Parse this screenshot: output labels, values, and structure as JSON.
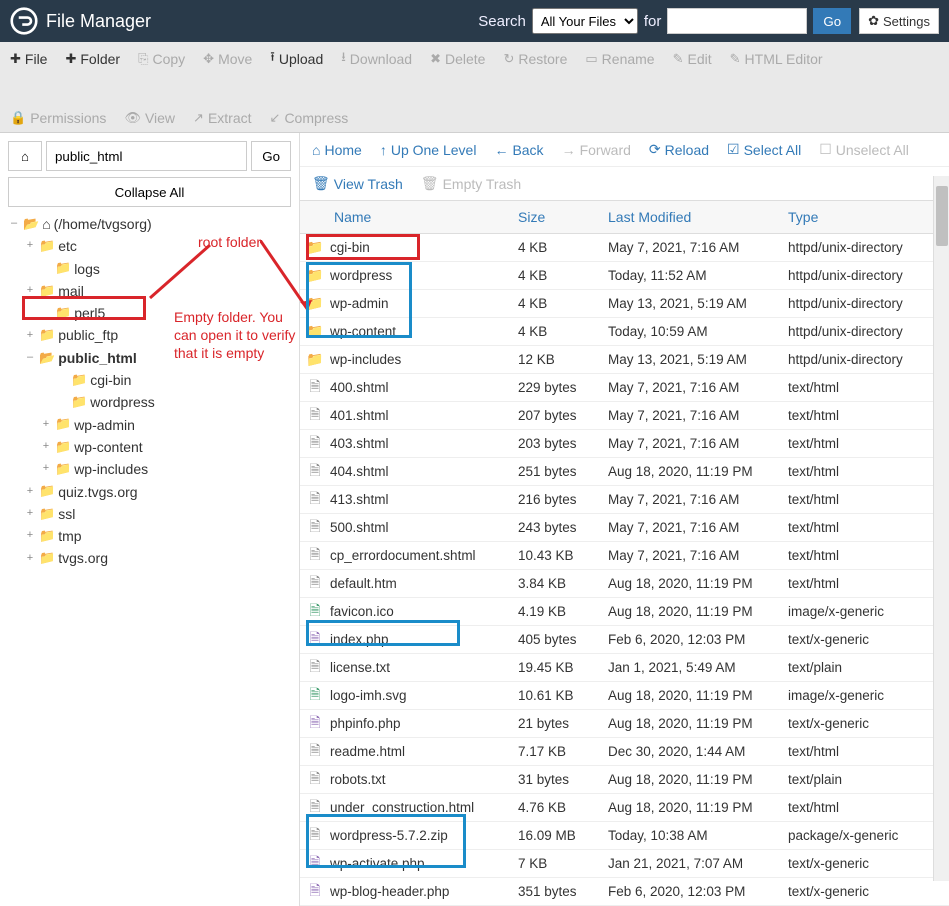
{
  "header": {
    "title": "File Manager",
    "search_label": "Search",
    "search_scope": "All Your Files",
    "for_label": "for",
    "search_value": "",
    "go_label": "Go",
    "settings_label": "Settings"
  },
  "toolbar": {
    "row1": [
      {
        "icon": "plus",
        "label": "File",
        "disabled": false
      },
      {
        "icon": "plus",
        "label": "Folder",
        "disabled": false
      },
      {
        "icon": "copy",
        "label": "Copy",
        "disabled": true
      },
      {
        "icon": "move",
        "label": "Move",
        "disabled": true
      },
      {
        "icon": "upload",
        "label": "Upload",
        "disabled": false
      },
      {
        "icon": "download",
        "label": "Download",
        "disabled": true
      },
      {
        "icon": "delete",
        "label": "Delete",
        "disabled": true
      },
      {
        "icon": "restore",
        "label": "Restore",
        "disabled": true
      },
      {
        "icon": "rename",
        "label": "Rename",
        "disabled": true
      },
      {
        "icon": "edit",
        "label": "Edit",
        "disabled": true
      },
      {
        "icon": "html",
        "label": "HTML Editor",
        "disabled": true
      }
    ],
    "row2": [
      {
        "icon": "perm",
        "label": "Permissions",
        "disabled": true
      },
      {
        "icon": "view",
        "label": "View",
        "disabled": true
      },
      {
        "icon": "extract",
        "label": "Extract",
        "disabled": true
      },
      {
        "icon": "compress",
        "label": "Compress",
        "disabled": true
      }
    ]
  },
  "sidebar": {
    "path_value": "public_html",
    "go_label": "Go",
    "collapse_label": "Collapse All",
    "root_label": "(/home/tvgsorg)",
    "tree": [
      {
        "ind": 1,
        "exp": "+",
        "open": false,
        "label": "etc"
      },
      {
        "ind": 2,
        "exp": "",
        "open": false,
        "label": "logs"
      },
      {
        "ind": 1,
        "exp": "+",
        "open": false,
        "label": "mail"
      },
      {
        "ind": 2,
        "exp": "",
        "open": false,
        "label": "perl5"
      },
      {
        "ind": 1,
        "exp": "+",
        "open": false,
        "label": "public_ftp"
      },
      {
        "ind": 1,
        "exp": "–",
        "open": true,
        "label": "public_html",
        "bold": true
      },
      {
        "ind": 3,
        "exp": "",
        "open": false,
        "label": "cgi-bin"
      },
      {
        "ind": 3,
        "exp": "",
        "open": false,
        "label": "wordpress"
      },
      {
        "ind": 2,
        "exp": "+",
        "open": false,
        "label": "wp-admin"
      },
      {
        "ind": 2,
        "exp": "+",
        "open": false,
        "label": "wp-content"
      },
      {
        "ind": 2,
        "exp": "+",
        "open": false,
        "label": "wp-includes"
      },
      {
        "ind": 1,
        "exp": "+",
        "open": false,
        "label": "quiz.tvgs.org"
      },
      {
        "ind": 1,
        "exp": "+",
        "open": false,
        "label": "ssl"
      },
      {
        "ind": 1,
        "exp": "+",
        "open": false,
        "label": "tmp"
      },
      {
        "ind": 1,
        "exp": "+",
        "open": false,
        "label": "tvgs.org"
      }
    ]
  },
  "nav": {
    "row1": [
      {
        "icon": "home",
        "label": "Home",
        "disabled": false
      },
      {
        "icon": "up",
        "label": "Up One Level",
        "disabled": false
      },
      {
        "icon": "back",
        "label": "Back",
        "disabled": false
      },
      {
        "icon": "fwd",
        "label": "Forward",
        "disabled": true
      },
      {
        "icon": "reload",
        "label": "Reload",
        "disabled": false
      },
      {
        "icon": "selall",
        "label": "Select All",
        "disabled": false
      },
      {
        "icon": "unsel",
        "label": "Unselect All",
        "disabled": true
      }
    ],
    "row2": [
      {
        "icon": "trash",
        "label": "View Trash",
        "disabled": false
      },
      {
        "icon": "empty",
        "label": "Empty Trash",
        "disabled": true
      }
    ]
  },
  "columns": {
    "name": "Name",
    "size": "Size",
    "modified": "Last Modified",
    "type": "Type"
  },
  "files": [
    {
      "icon": "folder",
      "name": "cgi-bin",
      "size": "4 KB",
      "modified": "May 7, 2021, 7:16 AM",
      "type": "httpd/unix-directory"
    },
    {
      "icon": "folder",
      "name": "wordpress",
      "size": "4 KB",
      "modified": "Today, 11:52 AM",
      "type": "httpd/unix-directory"
    },
    {
      "icon": "folder",
      "name": "wp-admin",
      "size": "4 KB",
      "modified": "May 13, 2021, 5:19 AM",
      "type": "httpd/unix-directory"
    },
    {
      "icon": "folder",
      "name": "wp-content",
      "size": "4 KB",
      "modified": "Today, 10:59 AM",
      "type": "httpd/unix-directory"
    },
    {
      "icon": "folder",
      "name": "wp-includes",
      "size": "12 KB",
      "modified": "May 13, 2021, 5:19 AM",
      "type": "httpd/unix-directory"
    },
    {
      "icon": "file",
      "name": "400.shtml",
      "size": "229 bytes",
      "modified": "May 7, 2021, 7:16 AM",
      "type": "text/html"
    },
    {
      "icon": "file",
      "name": "401.shtml",
      "size": "207 bytes",
      "modified": "May 7, 2021, 7:16 AM",
      "type": "text/html"
    },
    {
      "icon": "file",
      "name": "403.shtml",
      "size": "203 bytes",
      "modified": "May 7, 2021, 7:16 AM",
      "type": "text/html"
    },
    {
      "icon": "file",
      "name": "404.shtml",
      "size": "251 bytes",
      "modified": "Aug 18, 2020, 11:19 PM",
      "type": "text/html"
    },
    {
      "icon": "file",
      "name": "413.shtml",
      "size": "216 bytes",
      "modified": "May 7, 2021, 7:16 AM",
      "type": "text/html"
    },
    {
      "icon": "file",
      "name": "500.shtml",
      "size": "243 bytes",
      "modified": "May 7, 2021, 7:16 AM",
      "type": "text/html"
    },
    {
      "icon": "file",
      "name": "cp_errordocument.shtml",
      "size": "10.43 KB",
      "modified": "May 7, 2021, 7:16 AM",
      "type": "text/html"
    },
    {
      "icon": "file",
      "name": "default.htm",
      "size": "3.84 KB",
      "modified": "Aug 18, 2020, 11:19 PM",
      "type": "text/html"
    },
    {
      "icon": "img",
      "name": "favicon.ico",
      "size": "4.19 KB",
      "modified": "Aug 18, 2020, 11:19 PM",
      "type": "image/x-generic"
    },
    {
      "icon": "php",
      "name": "index.php",
      "size": "405 bytes",
      "modified": "Feb 6, 2020, 12:03 PM",
      "type": "text/x-generic"
    },
    {
      "icon": "file",
      "name": "license.txt",
      "size": "19.45 KB",
      "modified": "Jan 1, 2021, 5:49 AM",
      "type": "text/plain"
    },
    {
      "icon": "img",
      "name": "logo-imh.svg",
      "size": "10.61 KB",
      "modified": "Aug 18, 2020, 11:19 PM",
      "type": "image/x-generic"
    },
    {
      "icon": "php",
      "name": "phpinfo.php",
      "size": "21 bytes",
      "modified": "Aug 18, 2020, 11:19 PM",
      "type": "text/x-generic"
    },
    {
      "icon": "file",
      "name": "readme.html",
      "size": "7.17 KB",
      "modified": "Dec 30, 2020, 1:44 AM",
      "type": "text/html"
    },
    {
      "icon": "file",
      "name": "robots.txt",
      "size": "31 bytes",
      "modified": "Aug 18, 2020, 11:19 PM",
      "type": "text/plain"
    },
    {
      "icon": "file",
      "name": "under_construction.html",
      "size": "4.76 KB",
      "modified": "Aug 18, 2020, 11:19 PM",
      "type": "text/html"
    },
    {
      "icon": "file",
      "name": "wordpress-5.7.2.zip",
      "size": "16.09 MB",
      "modified": "Today, 10:38 AM",
      "type": "package/x-generic"
    },
    {
      "icon": "php",
      "name": "wp-activate.php",
      "size": "7 KB",
      "modified": "Jan 21, 2021, 7:07 AM",
      "type": "text/x-generic"
    },
    {
      "icon": "php",
      "name": "wp-blog-header.php",
      "size": "351 bytes",
      "modified": "Feb 6, 2020, 12:03 PM",
      "type": "text/x-generic"
    }
  ],
  "annotations": {
    "root_folder": "root folder",
    "empty_folder": "Empty folder. You can open it to verify that it is empty"
  }
}
